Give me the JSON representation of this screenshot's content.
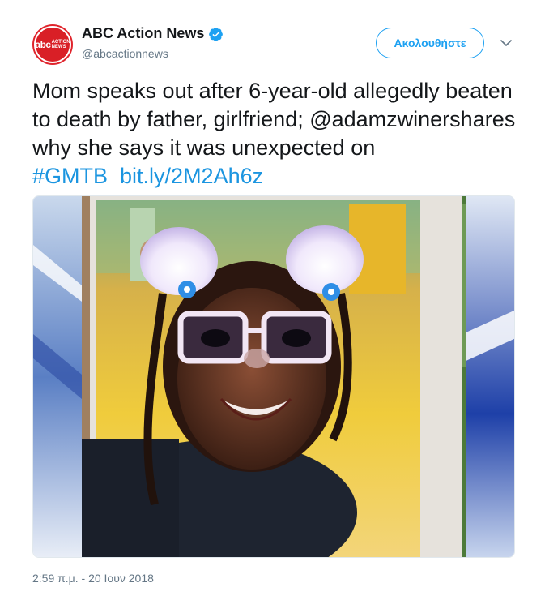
{
  "author": {
    "name": "ABC Action News",
    "handle": "@abcactionnews",
    "avatar_logo": "abc",
    "avatar_tag_line1": "ACTION",
    "avatar_tag_line2": "NEWS",
    "verified_icon": "verified-badge-icon"
  },
  "follow_label": "Ακολουθήστε",
  "menu_icon": "chevron-down-icon",
  "tweet": {
    "text_before": "Mom speaks out after 6-year-old allegedly beaten to death by father, girlfriend; @adamzwinershares why she says it was unexpected on ",
    "hashtag": "#GMTB",
    "link": "bit.ly/2M2Ah6z"
  },
  "timestamp": "2:59 π.μ. - 20 Ιουν 2018",
  "colors": {
    "accent": "#1da1f2",
    "link": "#1b95e0",
    "muted": "#657786",
    "brand": "#e0242c"
  }
}
